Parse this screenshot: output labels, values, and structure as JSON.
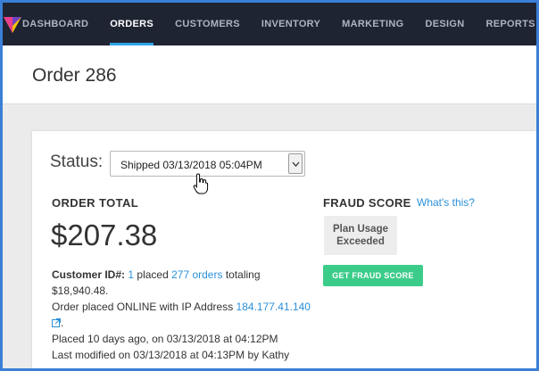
{
  "nav": {
    "items": [
      {
        "label": "DASHBOARD",
        "active": false
      },
      {
        "label": "ORDERS",
        "active": true
      },
      {
        "label": "CUSTOMERS",
        "active": false
      },
      {
        "label": "INVENTORY",
        "active": false
      },
      {
        "label": "MARKETING",
        "active": false
      },
      {
        "label": "DESIGN",
        "active": false
      },
      {
        "label": "REPORTS",
        "active": false
      }
    ]
  },
  "header": {
    "title": "Order 286"
  },
  "status": {
    "label": "Status:",
    "selected": "Shipped 03/13/2018 05:04PM"
  },
  "order_total": {
    "label": "ORDER TOTAL",
    "value": "$207.38"
  },
  "customer": {
    "id_label": "Customer ID#:",
    "id_value": "1",
    "placed_text": "placed",
    "orders_link": "277 orders",
    "totaling_text": "totaling",
    "total_amount": "$18,940.48."
  },
  "ip": {
    "prefix": "Order placed ONLINE with IP Address",
    "address": "184.177.41.140"
  },
  "placed_line": "Placed 10 days ago, on 03/13/2018 at 04:12PM",
  "modified_line": "Last modified on 03/13/2018 at 04:13PM by Kathy",
  "fraud": {
    "label": "FRAUD SCORE",
    "link": "What's this?",
    "plan_line1": "Plan Usage",
    "plan_line2": "Exceeded",
    "button": "GET FRAUD SCORE"
  },
  "colors": {
    "nav_bg": "#1f2433",
    "accent": "#2fa4e7",
    "link": "#2b90d9",
    "button_green": "#3ccc8a",
    "frame_border": "#3b7fd6"
  },
  "icons": [
    "logo-icon",
    "chevron-down-icon",
    "external-link-icon",
    "hand-cursor-icon"
  ]
}
